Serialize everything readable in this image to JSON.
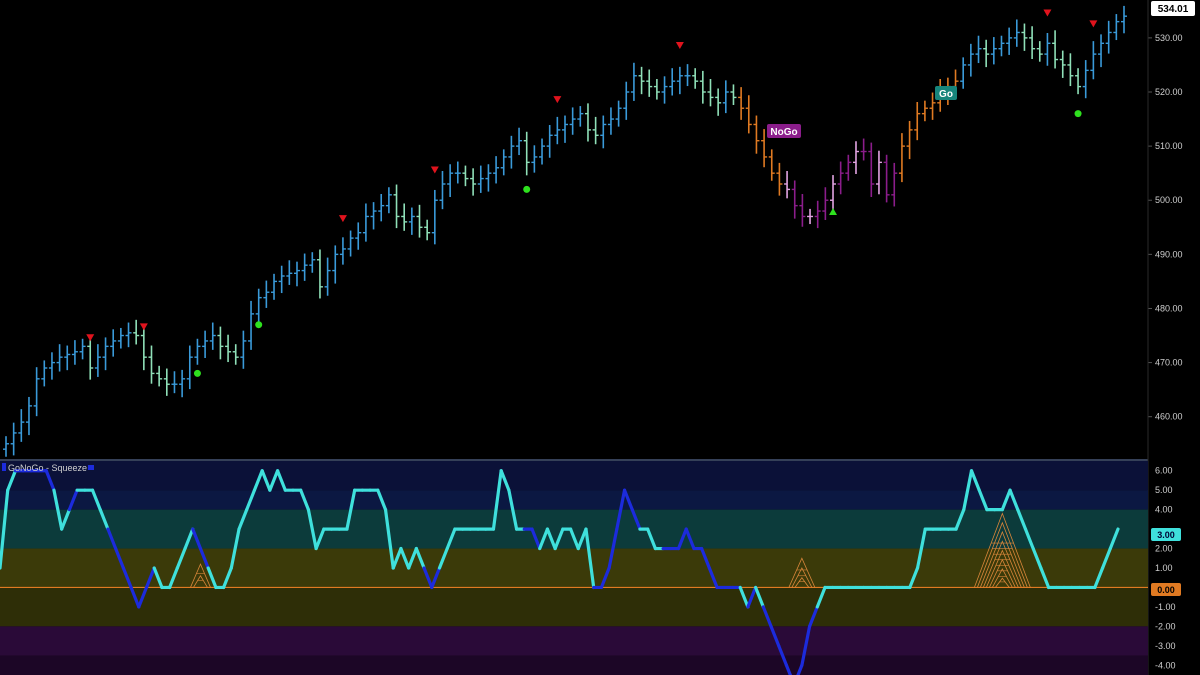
{
  "colors": {
    "background": "#000000",
    "go_strong": "#3a9ad9",
    "go_weak": "#8fe0b8",
    "nogo_strong": "#8b1d8b",
    "nogo_weak": "#e2a4e2",
    "neutral": "#e07a22",
    "trend_down_marker": "#e0131d",
    "trend_up_marker": "#2ee11e",
    "osc_cyan": "#3fe0dc",
    "osc_blue": "#1c2bdc",
    "squeeze": "#d8863a",
    "zero_line": "#e07a22"
  },
  "chart_data": [
    {
      "type": "ohlc",
      "name": "price",
      "y_axis": {
        "range": [
          452,
          537
        ],
        "ticks": [
          460,
          470,
          480,
          490,
          500,
          510,
          520,
          530
        ],
        "tick_labels": [
          "460.00",
          "470.00",
          "480.00",
          "490.00",
          "500.00",
          "510.00",
          "520.00",
          "530.00"
        ]
      },
      "last_price": 534.01,
      "last_price_label": "534.01",
      "bars_close": [
        455,
        457,
        459,
        462,
        467,
        469,
        470,
        471,
        471.5,
        472,
        473,
        469,
        471,
        473,
        474,
        475,
        475.5,
        475,
        471,
        468,
        467,
        466,
        466,
        467,
        471,
        473,
        474,
        475,
        473,
        472,
        471,
        474,
        479,
        482,
        483,
        485,
        486,
        486.5,
        487,
        488,
        489,
        484,
        487,
        490,
        491,
        493,
        494,
        497,
        498,
        499,
        501,
        497,
        496,
        497,
        495,
        494,
        500,
        503,
        505,
        505,
        504,
        503,
        504,
        505,
        506,
        508,
        510,
        511,
        507,
        508,
        510,
        512,
        513,
        514,
        515,
        516,
        513,
        512,
        514,
        515,
        517,
        520,
        523,
        522,
        521,
        520,
        521,
        522,
        523,
        523,
        522,
        520,
        519,
        518,
        520,
        519,
        517,
        514,
        511,
        508,
        505,
        503,
        502,
        499,
        497,
        497,
        498,
        500,
        503,
        505,
        507,
        509,
        509,
        503,
        507,
        501,
        505,
        510,
        513,
        516,
        517,
        518,
        520,
        521,
        522,
        525,
        527,
        528,
        527,
        528,
        529,
        530,
        531,
        530,
        528,
        527,
        529,
        526,
        525,
        523,
        521,
        524,
        527,
        529,
        531,
        533,
        534.01
      ],
      "trend_up_markers_bar": [
        0,
        25,
        33,
        68,
        108,
        140
      ],
      "trend_down_markers_bar": [
        11,
        18,
        44,
        56,
        72,
        88,
        136,
        142
      ],
      "go_label": "Go",
      "nogo_label": "NoGo"
    },
    {
      "type": "line",
      "name": "GoNoGo - Squeeze",
      "title": "GoNoGo - Squeeze",
      "y_axis": {
        "range": [
          -4.5,
          6.5
        ],
        "ticks": [
          6,
          5,
          4,
          3,
          2,
          1,
          0,
          -1,
          -2,
          -3,
          -4
        ],
        "tick_labels": [
          "6.00",
          "5.00",
          "4.00",
          "3.00",
          "2.00",
          "1.00",
          "0.00",
          "-1.00",
          "-2.00",
          "-3.00",
          "-4.00"
        ]
      },
      "last_value": 3.0,
      "last_value_label": "3.00",
      "zero_label": "0.00",
      "values": [
        1,
        5,
        6,
        6,
        6,
        6,
        6,
        5,
        3,
        4,
        5,
        5,
        5,
        4,
        3,
        2,
        1,
        0,
        -1,
        0,
        1,
        0,
        0,
        1,
        2,
        3,
        2,
        1,
        0,
        0,
        1,
        3,
        4,
        5,
        6,
        5,
        6,
        5,
        5,
        5,
        4,
        2,
        3,
        3,
        3,
        3,
        5,
        5,
        5,
        5,
        4,
        1,
        2,
        1,
        2,
        1,
        0,
        1,
        2,
        3,
        3,
        3,
        3,
        3,
        3,
        6,
        5,
        3,
        3,
        3,
        2,
        3,
        2,
        3,
        3,
        2,
        3,
        0,
        0,
        1,
        3,
        5,
        4,
        3,
        3,
        2,
        2,
        2,
        2,
        3,
        2,
        2,
        1,
        0,
        0,
        0,
        0,
        -1,
        0,
        -1,
        -2,
        -3,
        -4,
        -5,
        -4,
        -2,
        -1,
        0,
        0,
        0,
        0,
        0,
        0,
        0,
        0,
        0,
        0,
        0,
        0,
        1,
        3,
        3,
        3,
        3,
        3,
        4,
        6,
        5,
        4,
        4,
        4,
        5,
        4,
        3,
        2,
        1,
        0,
        0,
        0,
        0,
        0,
        0,
        0,
        1,
        2,
        3
      ],
      "segment_colors": [
        "cyan",
        "cyan",
        "blue",
        "blue",
        "blue",
        "blue",
        "blue",
        "cyan",
        "cyan",
        "blue",
        "cyan",
        "cyan",
        "cyan",
        "cyan",
        "blue",
        "blue",
        "blue",
        "blue",
        "blue",
        "blue",
        "cyan",
        "cyan",
        "cyan",
        "cyan",
        "cyan",
        "blue",
        "blue",
        "cyan",
        "cyan",
        "cyan",
        "cyan",
        "cyan",
        "cyan",
        "cyan",
        "cyan",
        "cyan",
        "cyan",
        "cyan",
        "cyan",
        "cyan",
        "cyan",
        "cyan",
        "cyan",
        "cyan",
        "cyan",
        "cyan",
        "cyan",
        "cyan",
        "cyan",
        "cyan",
        "cyan",
        "cyan",
        "cyan",
        "cyan",
        "cyan",
        "blue",
        "blue",
        "cyan",
        "cyan",
        "cyan",
        "cyan",
        "cyan",
        "cyan",
        "cyan",
        "cyan",
        "cyan",
        "cyan",
        "cyan",
        "blue",
        "blue",
        "cyan",
        "cyan",
        "cyan",
        "cyan",
        "cyan",
        "cyan",
        "cyan",
        "blue",
        "blue",
        "blue",
        "blue",
        "blue",
        "blue",
        "cyan",
        "cyan",
        "cyan",
        "blue",
        "blue",
        "blue",
        "blue",
        "blue",
        "blue",
        "blue",
        "blue",
        "blue",
        "blue",
        "cyan",
        "blue",
        "cyan",
        "blue",
        "blue",
        "blue",
        "blue",
        "blue",
        "blue",
        "blue",
        "cyan",
        "cyan",
        "cyan",
        "cyan",
        "cyan",
        "cyan",
        "cyan",
        "cyan",
        "cyan",
        "cyan",
        "cyan",
        "cyan",
        "cyan",
        "cyan",
        "cyan",
        "cyan",
        "cyan",
        "cyan",
        "cyan",
        "cyan",
        "cyan",
        "cyan",
        "cyan",
        "cyan",
        "cyan",
        "cyan",
        "cyan",
        "cyan",
        "cyan",
        "cyan",
        "cyan",
        "cyan",
        "cyan",
        "cyan",
        "cyan",
        "cyan",
        "cyan",
        "cyan",
        "cyan",
        "cyan",
        "cyan",
        "cyan"
      ],
      "squeeze_peaks": [
        {
          "bar": 26,
          "height": 1.2
        },
        {
          "bar": 104,
          "height": 1.5
        },
        {
          "bar": 130,
          "height": 3.8
        },
        {
          "bar": 159,
          "height": 3.2
        }
      ]
    }
  ]
}
